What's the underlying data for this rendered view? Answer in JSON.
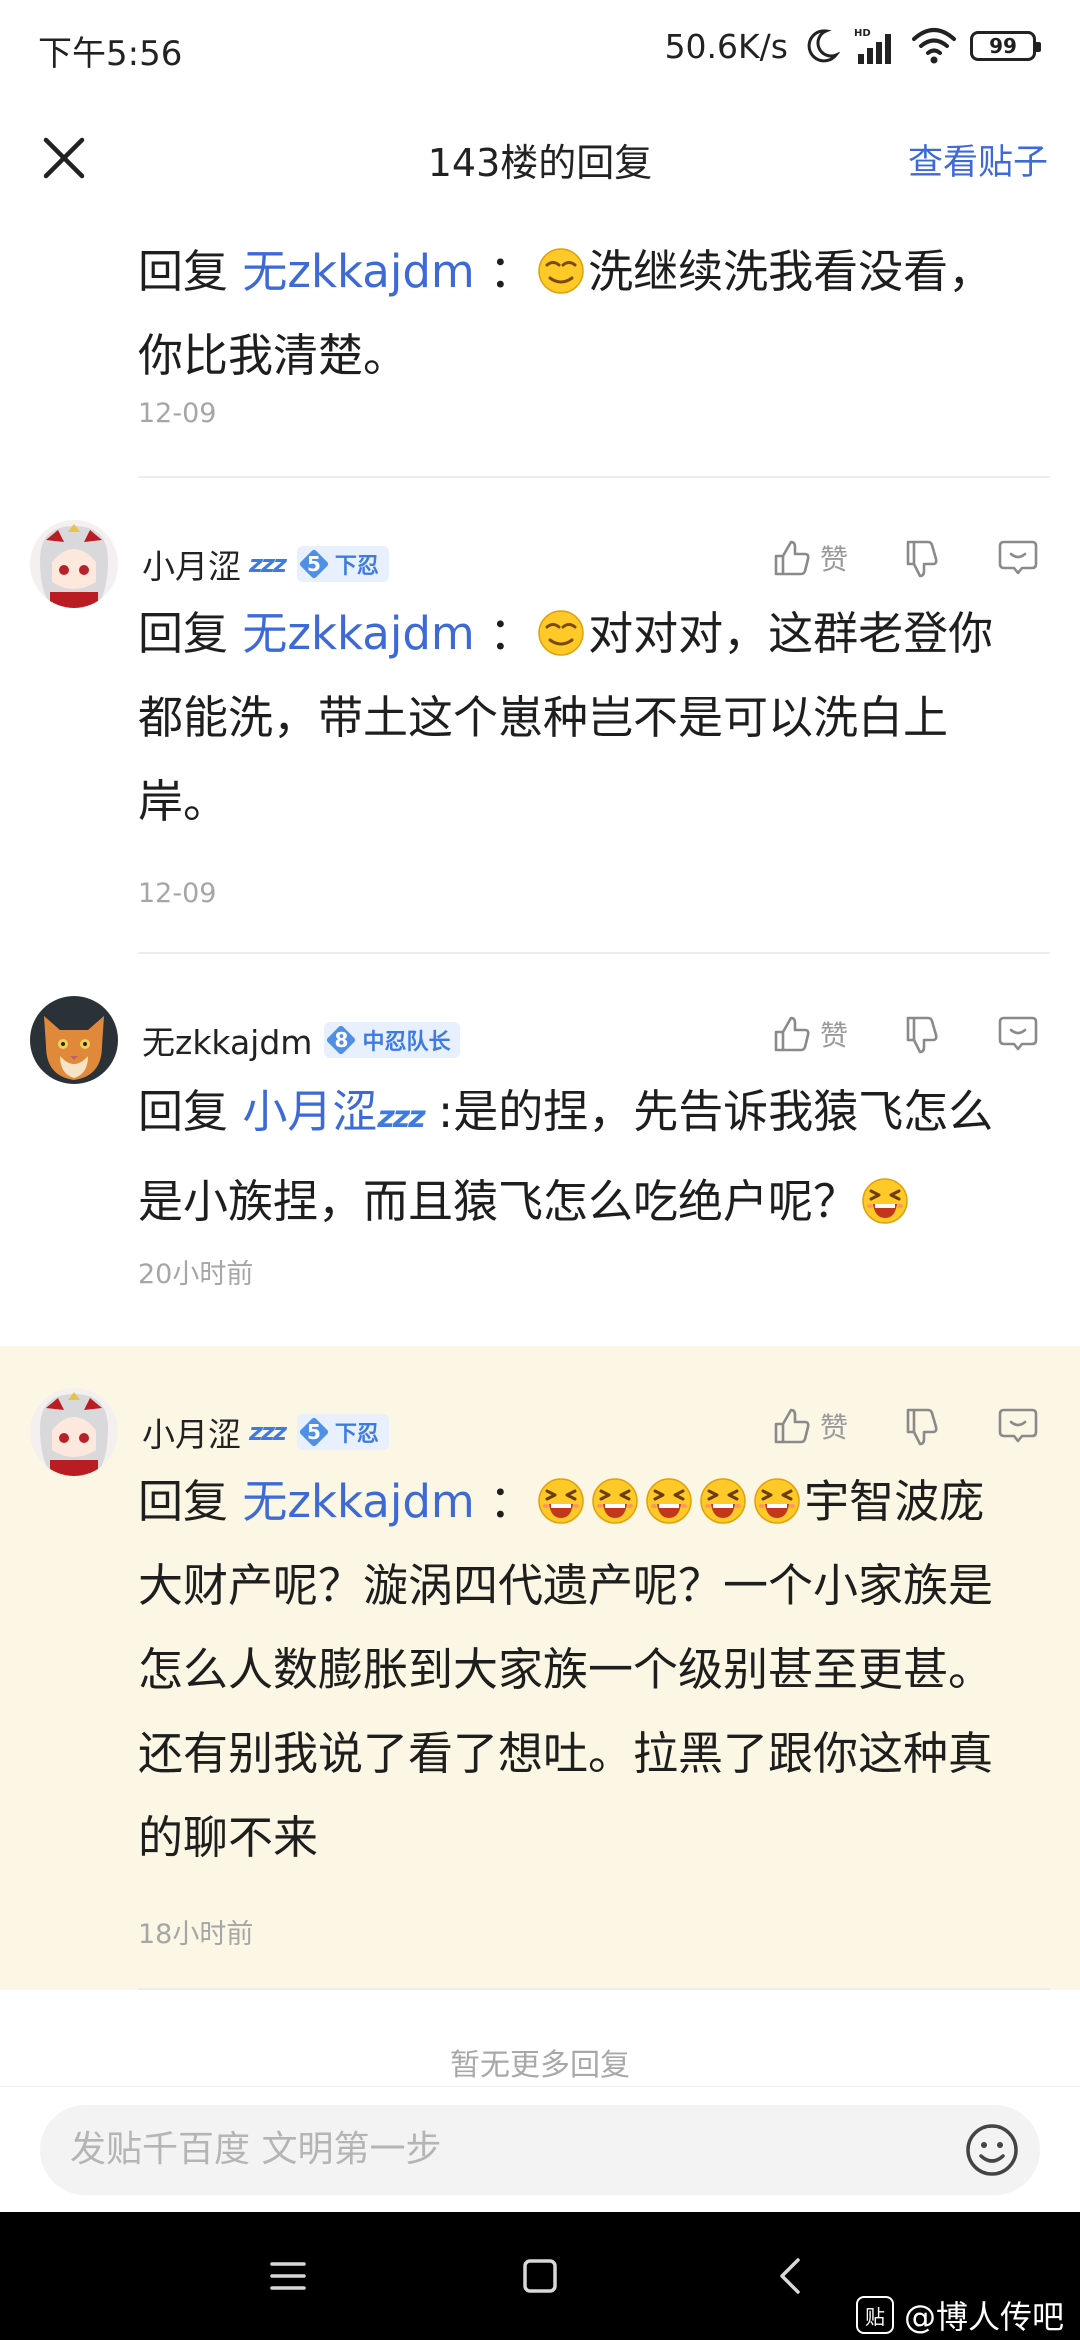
{
  "status_bar": {
    "time": "下午5:56",
    "net_speed": "50.6K/s",
    "signal_label": "HD",
    "battery": "99"
  },
  "header": {
    "title": "143楼的回复",
    "view_post": "查看贴子"
  },
  "comments": [
    {
      "reply_prefix": "回复",
      "mention": "无zkkajdm",
      "colon": "：",
      "text": "洗继续洗我看没看，你比我清楚。",
      "time": "12-09"
    },
    {
      "username": "小月涩",
      "zzz": "z",
      "level": "5",
      "level_title": "下忍",
      "like_label": "赞",
      "reply_prefix": "回复",
      "mention": "无zkkajdm",
      "colon": "：",
      "text": "对对对，这群老登你都能洗，带土这个崽种岂不是可以洗白上岸。",
      "time": "12-09"
    },
    {
      "username": "无zkkajdm",
      "level": "8",
      "level_title": "中忍队长",
      "like_label": "赞",
      "reply_prefix": "回复",
      "mention": "小月涩",
      "text": ":是的捏，先告诉我猿飞怎么是小族捏，而且猿飞怎么吃绝户呢？",
      "time": "20小时前"
    },
    {
      "username": "小月涩",
      "level": "5",
      "level_title": "下忍",
      "like_label": "赞",
      "reply_prefix": "回复",
      "mention": "无zkkajdm",
      "colon": "：",
      "text": "宇智波庞大财产呢？漩涡四代遗产呢？一个小家族是怎么人数膨胀到大家族一个级别甚至更甚。还有别我说了看了想吐。拉黑了跟你这种真的聊不来",
      "time": "18小时前"
    }
  ],
  "no_more": "暂无更多回复",
  "input": {
    "placeholder": "发贴千百度 文明第一步"
  },
  "watermark": {
    "logo": "贴",
    "text": "@博人传吧"
  },
  "colors": {
    "accent": "#3e6ad8",
    "highlight_bg": "#fbf7e4",
    "badge": "#4f8fe6"
  }
}
